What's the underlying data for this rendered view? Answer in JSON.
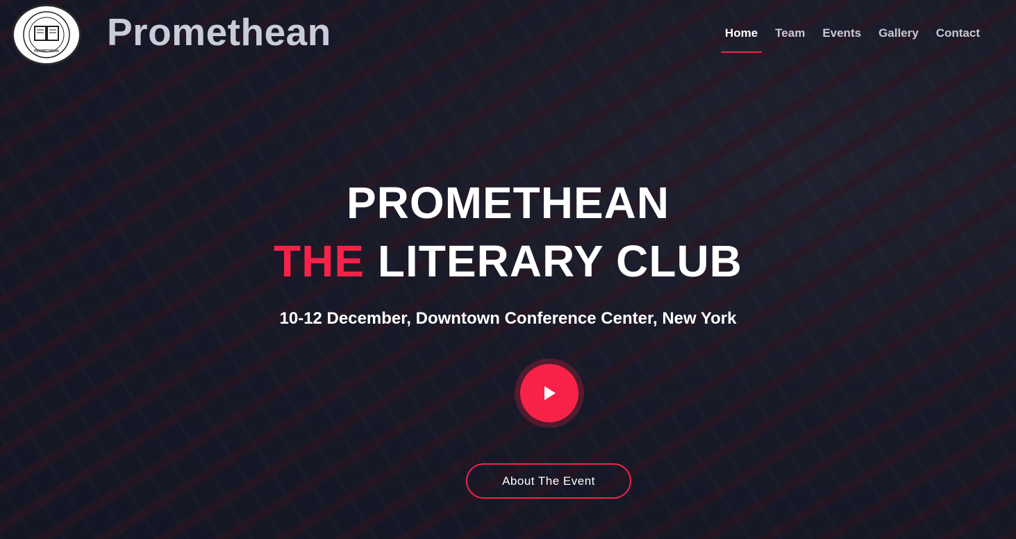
{
  "brand": {
    "name": "Promethean",
    "logo_icon": "book-seal-icon",
    "logo_text": "PROMETHEAN"
  },
  "nav": {
    "items": [
      {
        "label": "Home",
        "active": true
      },
      {
        "label": "Team",
        "active": false
      },
      {
        "label": "Events",
        "active": false
      },
      {
        "label": "Gallery",
        "active": false
      },
      {
        "label": "Contact",
        "active": false
      }
    ]
  },
  "hero": {
    "title_line1": "PROMETHEAN",
    "title_accent": "THE",
    "title_rest": " LITERARY CLUB",
    "subtitle": "10-12 December, Downtown Conference Center, New York",
    "play_icon": "play-icon",
    "cta_label": "About The Event"
  },
  "colors": {
    "accent": "#f82249",
    "overlay": "#101220",
    "nav_text": "#c7cad6",
    "white": "#ffffff"
  }
}
